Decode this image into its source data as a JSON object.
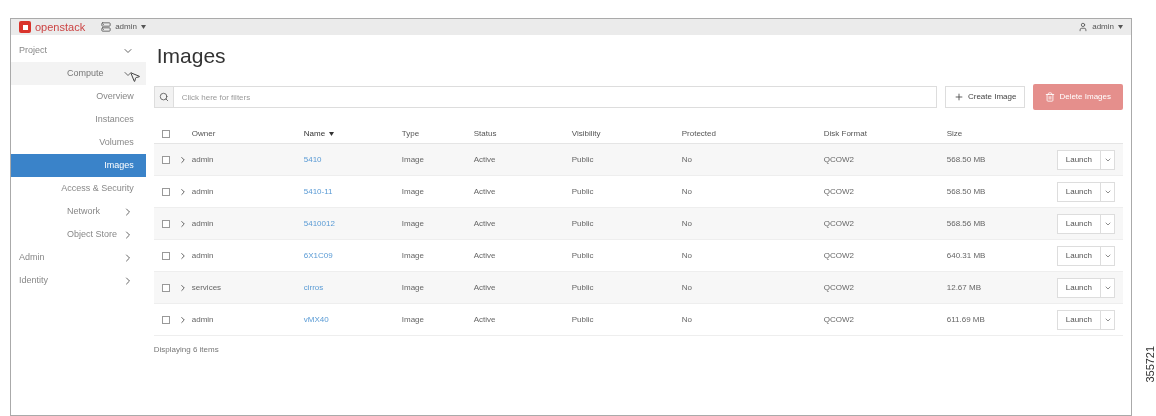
{
  "topbar": {
    "brand": "openstack",
    "project_menu": "admin",
    "user_menu": "admin"
  },
  "sidebar": {
    "items": [
      {
        "label": "Project",
        "expanded": true,
        "selected": false,
        "children": [
          {
            "label": "Compute",
            "expanded": true,
            "selected": false,
            "children": [
              {
                "label": "Overview",
                "selected": false
              },
              {
                "label": "Instances",
                "selected": false
              },
              {
                "label": "Volumes",
                "selected": false
              },
              {
                "label": "Images",
                "selected": true
              },
              {
                "label": "Access & Security",
                "selected": false
              }
            ]
          },
          {
            "label": "Network",
            "expanded": false,
            "selected": false
          },
          {
            "label": "Object Store",
            "expanded": false,
            "selected": false
          }
        ]
      },
      {
        "label": "Admin",
        "expanded": false,
        "selected": false
      },
      {
        "label": "Identity",
        "expanded": false,
        "selected": false
      }
    ]
  },
  "page": {
    "title": "Images",
    "search": {
      "placeholder": "Click here for filters"
    },
    "create_button": "Create Image",
    "delete_button": {
      "label": "Delete Images",
      "disabled": true
    }
  },
  "table": {
    "select_all_checked": false,
    "columns": [
      {
        "label": "Owner",
        "sorted": false
      },
      {
        "label": "Name",
        "sorted": true
      },
      {
        "label": "Type",
        "sorted": false
      },
      {
        "label": "Status",
        "sorted": false
      },
      {
        "label": "Visibility",
        "sorted": false
      },
      {
        "label": "Protected",
        "sorted": false
      },
      {
        "label": "Disk Format",
        "sorted": false
      },
      {
        "label": "Size",
        "sorted": false
      }
    ],
    "rows": [
      {
        "checked": false,
        "owner": "admin",
        "name": "5410",
        "type": "Image",
        "status": "Active",
        "visibility": "Public",
        "protected": "No",
        "disk_format": "QCOW2",
        "size": "568.50 MB",
        "action": "Launch"
      },
      {
        "checked": false,
        "owner": "admin",
        "name": "5410-11",
        "type": "Image",
        "status": "Active",
        "visibility": "Public",
        "protected": "No",
        "disk_format": "QCOW2",
        "size": "568.50 MB",
        "action": "Launch"
      },
      {
        "checked": false,
        "owner": "admin",
        "name": "5410012",
        "type": "Image",
        "status": "Active",
        "visibility": "Public",
        "protected": "No",
        "disk_format": "QCOW2",
        "size": "568.56 MB",
        "action": "Launch"
      },
      {
        "checked": false,
        "owner": "admin",
        "name": "6X1C09",
        "type": "Image",
        "status": "Active",
        "visibility": "Public",
        "protected": "No",
        "disk_format": "QCOW2",
        "size": "640.31 MB",
        "action": "Launch"
      },
      {
        "checked": false,
        "owner": "services",
        "name": "cirros",
        "type": "Image",
        "status": "Active",
        "visibility": "Public",
        "protected": "No",
        "disk_format": "QCOW2",
        "size": "12.67 MB",
        "action": "Launch"
      },
      {
        "checked": false,
        "owner": "admin",
        "name": "vMX40",
        "type": "Image",
        "status": "Active",
        "visibility": "Public",
        "protected": "No",
        "disk_format": "QCOW2",
        "size": "611.69 MB",
        "action": "Launch"
      }
    ],
    "footer": "Displaying 6 items"
  },
  "figure_number": "355721"
}
